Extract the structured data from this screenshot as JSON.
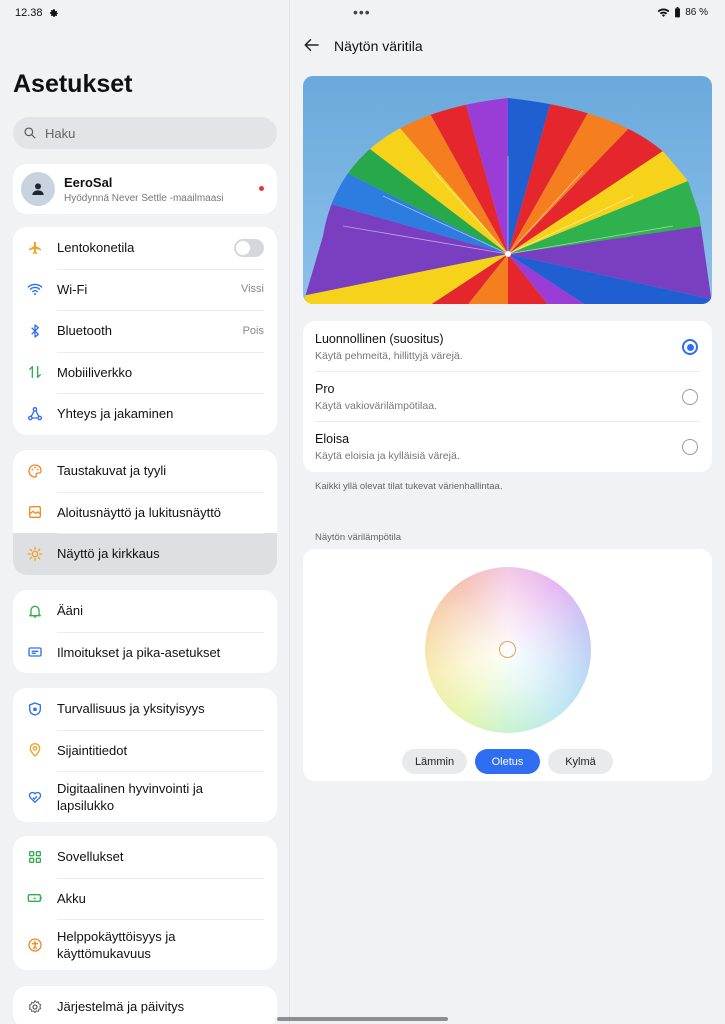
{
  "status": {
    "time": "12.38",
    "battery": "86 %"
  },
  "settings": {
    "title": "Asetukset",
    "search_placeholder": "Haku",
    "account": {
      "name": "EeroSal",
      "subtitle": "Hyödynnä Never Settle -maailmaasi"
    },
    "group1": [
      {
        "label": "Lentokonetila",
        "icon": "airplane-icon"
      },
      {
        "label": "Wi-Fi",
        "value": "Vissi",
        "icon": "wifi-icon"
      },
      {
        "label": "Bluetooth",
        "value": "Pois",
        "icon": "bluetooth-icon"
      },
      {
        "label": "Mobiiliverkko",
        "icon": "mobile-network-icon"
      },
      {
        "label": "Yhteys ja jakaminen",
        "icon": "share-icon"
      }
    ],
    "group2": [
      {
        "label": "Taustakuvat ja tyyli",
        "icon": "palette-icon"
      },
      {
        "label": "Aloitusnäyttö ja lukitusnäyttö",
        "icon": "home-screen-icon"
      },
      {
        "label": "Näyttö ja kirkkaus",
        "icon": "brightness-icon"
      }
    ],
    "group3": [
      {
        "label": "Ääni",
        "icon": "bell-icon"
      },
      {
        "label": "Ilmoitukset ja pika-asetukset",
        "icon": "notification-icon"
      }
    ],
    "group4": [
      {
        "label": "Turvallisuus ja yksityisyys",
        "icon": "shield-icon"
      },
      {
        "label": "Sijaintitiedot",
        "icon": "location-icon"
      },
      {
        "label": "Digitaalinen hyvinvointi ja lapsilukko",
        "icon": "wellbeing-icon"
      }
    ],
    "group5": [
      {
        "label": "Sovellukset",
        "icon": "apps-icon"
      },
      {
        "label": "Akku",
        "icon": "battery-icon"
      },
      {
        "label": "Helppokäyttöisyys ja käyttömukavuus",
        "icon": "accessibility-icon"
      }
    ],
    "group6": [
      {
        "label": "Järjestelmä ja päivitys",
        "icon": "gear-icon"
      }
    ]
  },
  "detail": {
    "title": "Näytön väritila",
    "modes": [
      {
        "title": "Luonnollinen (suositus)",
        "subtitle": "Käytä pehmeitä, hillittyjä värejä.",
        "selected": true
      },
      {
        "title": "Pro",
        "subtitle": "Käytä vakiovärilämpötilaa.",
        "selected": false
      },
      {
        "title": "Eloisa",
        "subtitle": "Käytä eloisia ja kylläisiä värejä.",
        "selected": false
      }
    ],
    "note": "Kaikki yllä olevat tilat tukevat värienhallintaa.",
    "temp_label": "Näytön värilämpötila",
    "temp_options": [
      "Lämmin",
      "Oletus",
      "Kylmä"
    ],
    "temp_selected": "Oletus"
  }
}
